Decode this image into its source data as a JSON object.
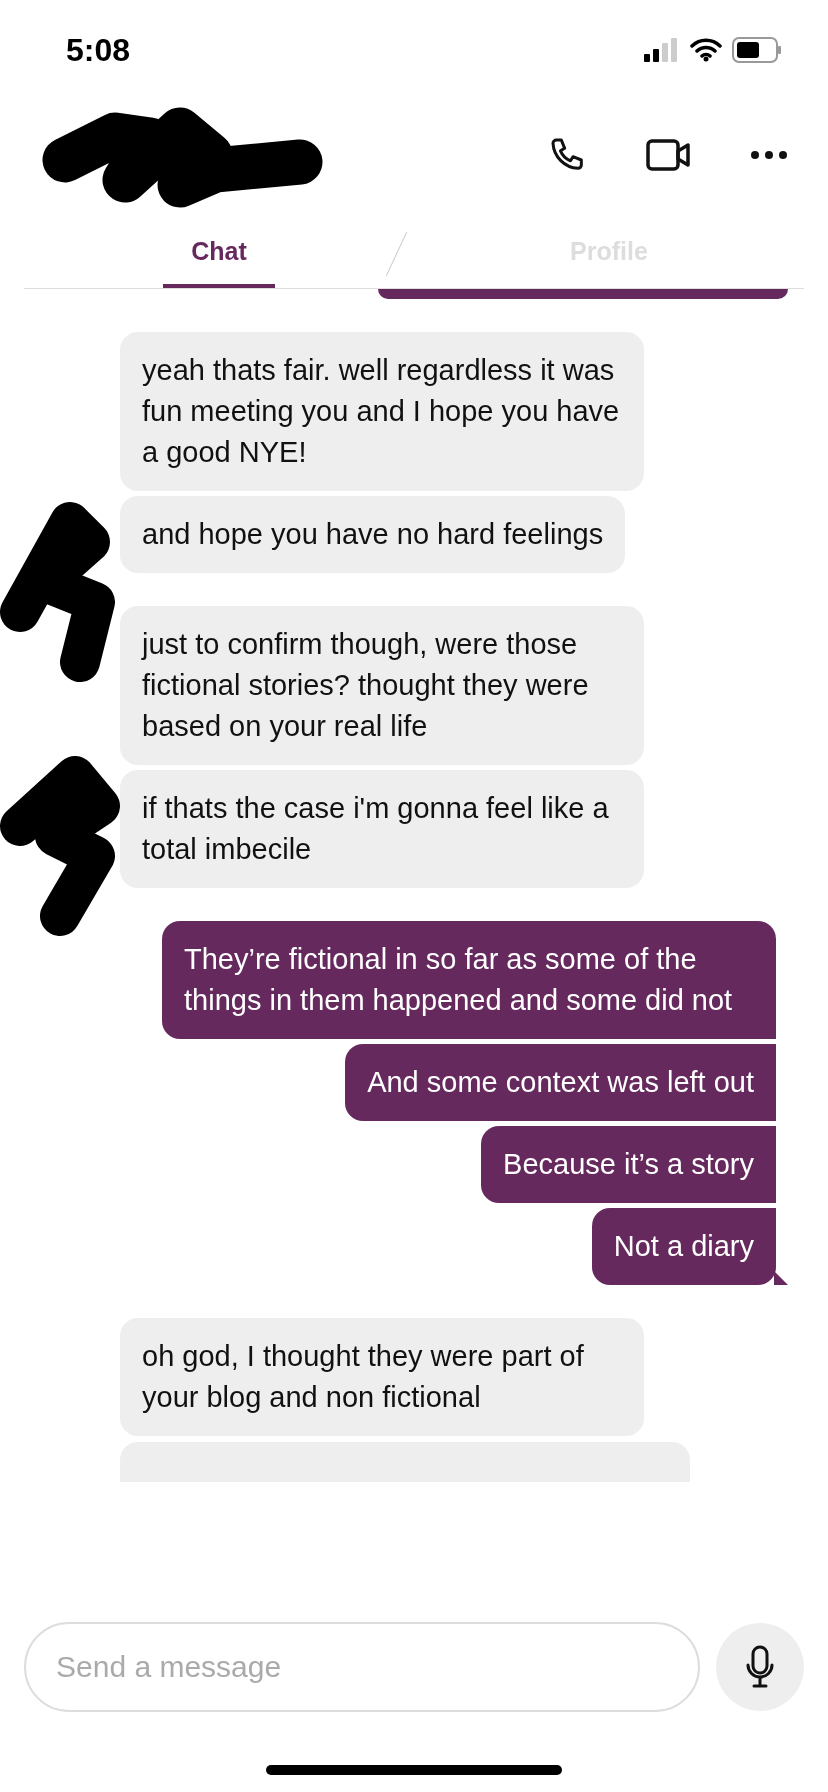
{
  "status_bar": {
    "time": "5:08"
  },
  "tabs": [
    {
      "label": "Chat",
      "selected": true
    },
    {
      "label": "Profile",
      "selected": false
    }
  ],
  "conversation": {
    "partial_top": true,
    "partial_bottom": true,
    "groups": [
      {
        "kind": "received",
        "redacted_avatar": true,
        "messages": [
          "yeah thats fair. well regardless it was fun meeting you and I hope you have a good NYE!",
          "and hope you have no hard feelings"
        ]
      },
      {
        "kind": "received",
        "redacted_avatar": true,
        "messages": [
          "just to confirm though, were those fictional stories? thought they were based on your real life",
          "if thats the case i'm gonna feel like a total imbecile"
        ]
      },
      {
        "kind": "sent",
        "redacted_avatar": false,
        "messages": [
          "They’re fictional in so far as some of the things in them happened and some did not",
          "And some context was left out",
          "Because it’s a story",
          "Not a diary"
        ]
      },
      {
        "kind": "received",
        "redacted_avatar": false,
        "messages": [
          "oh god, I thought they were part of your blog and non fictional"
        ]
      }
    ]
  },
  "composer": {
    "placeholder": "Send a message"
  }
}
